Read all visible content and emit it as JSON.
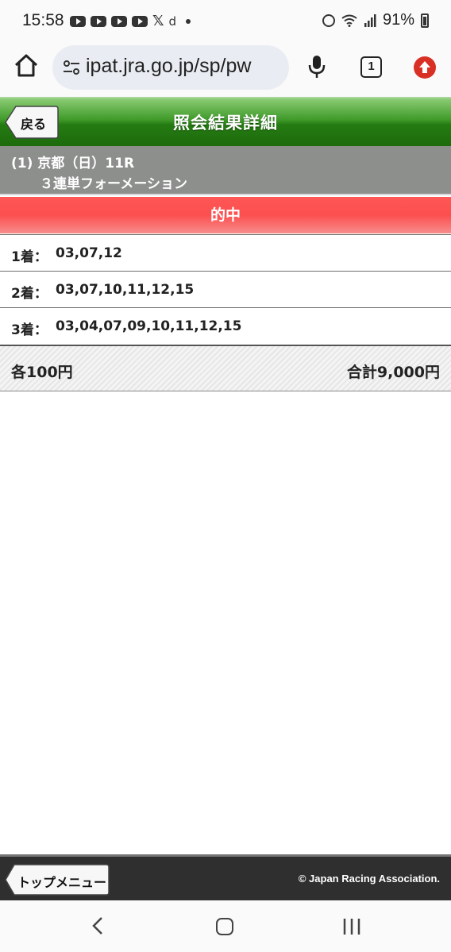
{
  "status_bar": {
    "time": "15:58",
    "battery": "91%",
    "notification_icons": [
      "youtube-icon",
      "youtube-icon",
      "youtube-icon",
      "youtube-icon",
      "x-icon",
      "docomo-icon"
    ]
  },
  "browser": {
    "url": "ipat.jra.go.jp/sp/pw",
    "tab_count": "1"
  },
  "header": {
    "back_label": "戻る",
    "title": "照会結果詳細"
  },
  "race": {
    "line1": "(1) 京都（日）11R",
    "line2": "３連単フォーメーション"
  },
  "result": {
    "label": "的中",
    "color": "#fc4f4f"
  },
  "rows": [
    {
      "label": "1着：",
      "value": "03,07,12"
    },
    {
      "label": "2着：",
      "value": "03,07,10,11,12,15"
    },
    {
      "label": "3着：",
      "value": "03,04,07,09,10,11,12,15"
    }
  ],
  "summary": {
    "unit_price": "各100円",
    "total": "合計9,000円"
  },
  "footer": {
    "top_menu_label": "トップメニュー",
    "copyright": "© Japan Racing Association."
  },
  "colors": {
    "header_green": "#257b12",
    "race_gray": "#8c8f8c",
    "footer_dark": "#2f2f2f",
    "update_red": "#d93025"
  }
}
